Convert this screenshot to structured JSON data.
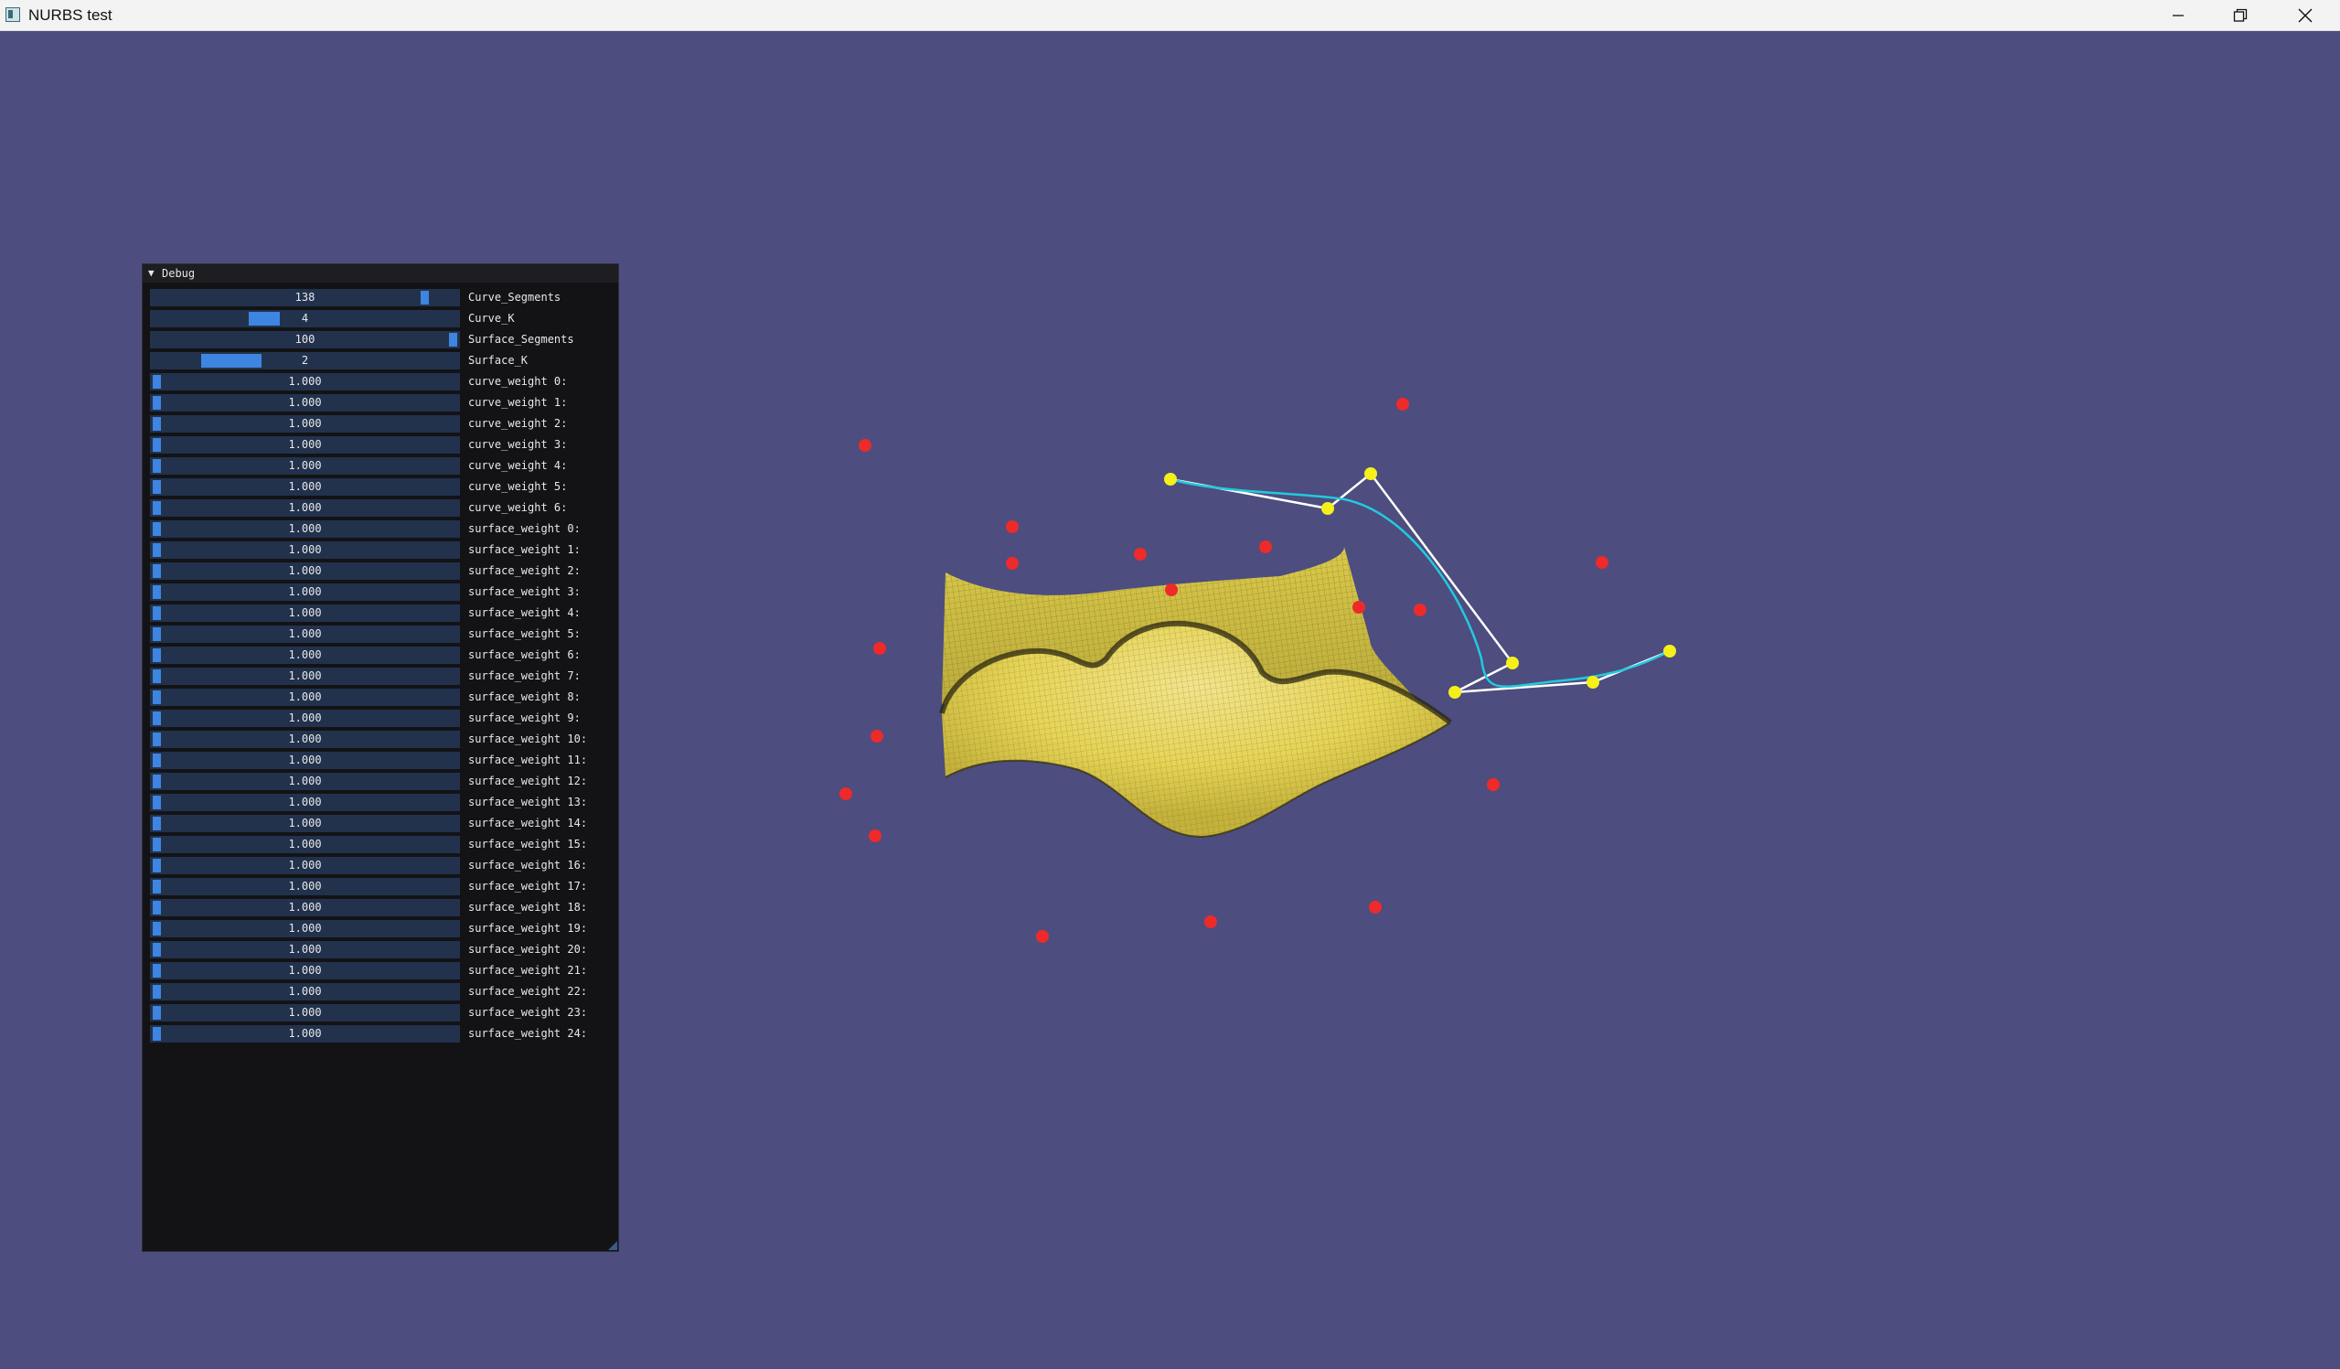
{
  "window": {
    "title": "NURBS test",
    "icon": "app-icon"
  },
  "panel": {
    "title": "Debug",
    "collapse_icon": "triangle-down-icon",
    "sliders": [
      {
        "value": "138",
        "label": "Curve_Segments",
        "fraction": 0.905
      },
      {
        "value": "4",
        "label": "Curve_K",
        "fraction": 0.35
      },
      {
        "value": "100",
        "label": "Surface_Segments",
        "fraction": 1.0
      },
      {
        "value": "2",
        "label": "Surface_K",
        "fraction": 0.2
      },
      {
        "value": "1.000",
        "label": "curve_weight 0:",
        "fraction": 0.0
      },
      {
        "value": "1.000",
        "label": "curve_weight 1:",
        "fraction": 0.0
      },
      {
        "value": "1.000",
        "label": "curve_weight 2:",
        "fraction": 0.0
      },
      {
        "value": "1.000",
        "label": "curve_weight 3:",
        "fraction": 0.0
      },
      {
        "value": "1.000",
        "label": "curve_weight 4:",
        "fraction": 0.0
      },
      {
        "value": "1.000",
        "label": "curve_weight 5:",
        "fraction": 0.0
      },
      {
        "value": "1.000",
        "label": "curve_weight 6:",
        "fraction": 0.0
      },
      {
        "value": "1.000",
        "label": "surface_weight 0:",
        "fraction": 0.0
      },
      {
        "value": "1.000",
        "label": "surface_weight 1:",
        "fraction": 0.0
      },
      {
        "value": "1.000",
        "label": "surface_weight 2:",
        "fraction": 0.0
      },
      {
        "value": "1.000",
        "label": "surface_weight 3:",
        "fraction": 0.0
      },
      {
        "value": "1.000",
        "label": "surface_weight 4:",
        "fraction": 0.0
      },
      {
        "value": "1.000",
        "label": "surface_weight 5:",
        "fraction": 0.0
      },
      {
        "value": "1.000",
        "label": "surface_weight 6:",
        "fraction": 0.0
      },
      {
        "value": "1.000",
        "label": "surface_weight 7:",
        "fraction": 0.0
      },
      {
        "value": "1.000",
        "label": "surface_weight 8:",
        "fraction": 0.0
      },
      {
        "value": "1.000",
        "label": "surface_weight 9:",
        "fraction": 0.0
      },
      {
        "value": "1.000",
        "label": "surface_weight 10:",
        "fraction": 0.0
      },
      {
        "value": "1.000",
        "label": "surface_weight 11:",
        "fraction": 0.0
      },
      {
        "value": "1.000",
        "label": "surface_weight 12:",
        "fraction": 0.0
      },
      {
        "value": "1.000",
        "label": "surface_weight 13:",
        "fraction": 0.0
      },
      {
        "value": "1.000",
        "label": "surface_weight 14:",
        "fraction": 0.0
      },
      {
        "value": "1.000",
        "label": "surface_weight 15:",
        "fraction": 0.0
      },
      {
        "value": "1.000",
        "label": "surface_weight 16:",
        "fraction": 0.0
      },
      {
        "value": "1.000",
        "label": "surface_weight 17:",
        "fraction": 0.0
      },
      {
        "value": "1.000",
        "label": "surface_weight 18:",
        "fraction": 0.0
      },
      {
        "value": "1.000",
        "label": "surface_weight 19:",
        "fraction": 0.0
      },
      {
        "value": "1.000",
        "label": "surface_weight 20:",
        "fraction": 0.0
      },
      {
        "value": "1.000",
        "label": "surface_weight 21:",
        "fraction": 0.0
      },
      {
        "value": "1.000",
        "label": "surface_weight 22:",
        "fraction": 0.0
      },
      {
        "value": "1.000",
        "label": "surface_weight 23:",
        "fraction": 0.0
      },
      {
        "value": "1.000",
        "label": "surface_weight 24:",
        "fraction": 0.0
      }
    ]
  },
  "colors": {
    "background": "#4d4d7f",
    "surface": "#e8d64a",
    "curve": "#23c9dc",
    "control_polygon": "#ffffff",
    "curve_control_points": "#f5f01a",
    "surface_control_points": "#ee2a2a",
    "slider_grab": "#3d85e0"
  }
}
